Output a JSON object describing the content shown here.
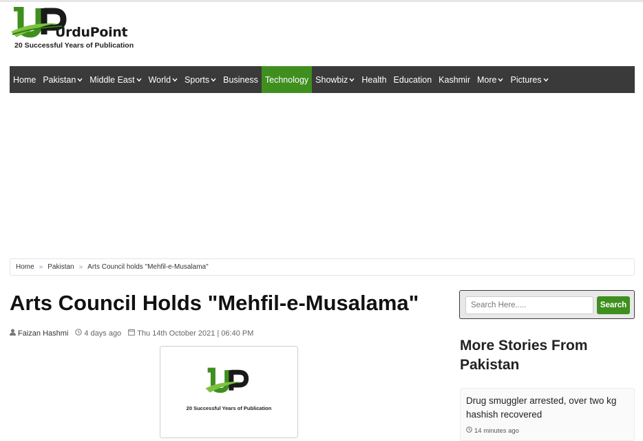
{
  "logo": {
    "name": "UrduPoint",
    "tagline": "20 Successful Years of Publication"
  },
  "nav": {
    "items": [
      {
        "label": "Home",
        "dropdown": false
      },
      {
        "label": "Pakistan",
        "dropdown": true
      },
      {
        "label": "Middle East",
        "dropdown": true
      },
      {
        "label": "World",
        "dropdown": true
      },
      {
        "label": "Sports",
        "dropdown": true
      },
      {
        "label": "Business",
        "dropdown": false
      },
      {
        "label": "Technology",
        "dropdown": false,
        "active": true
      },
      {
        "label": "Showbiz",
        "dropdown": true
      },
      {
        "label": "Health",
        "dropdown": false
      },
      {
        "label": "Education",
        "dropdown": false
      },
      {
        "label": "Kashmir",
        "dropdown": false
      },
      {
        "label": "More",
        "dropdown": true
      },
      {
        "label": "Pictures",
        "dropdown": true
      }
    ]
  },
  "breadcrumb": {
    "home": "Home",
    "section": "Pakistan",
    "current": "Arts Council holds \"Mehfil-e-Musalama\""
  },
  "article": {
    "title": "Arts Council Holds \"Mehfil-e-Musalama\"",
    "author": "Faizan Hashmi",
    "relative_time": "4 days ago",
    "date": "Thu 14th October 2021 | 06:40 PM",
    "image_tagline": "20 Successful Years of Publication"
  },
  "search": {
    "placeholder": "Search Here.....",
    "button": "Search"
  },
  "sidebar": {
    "heading": "More Stories From Pakistan",
    "stories": [
      {
        "title": "Drug smuggler arrested, over two kg hashish recovered",
        "time": "14 minutes ago"
      }
    ]
  },
  "colors": {
    "nav_bg": "#3a3a3a",
    "accent_green": "#3f8f1f"
  }
}
